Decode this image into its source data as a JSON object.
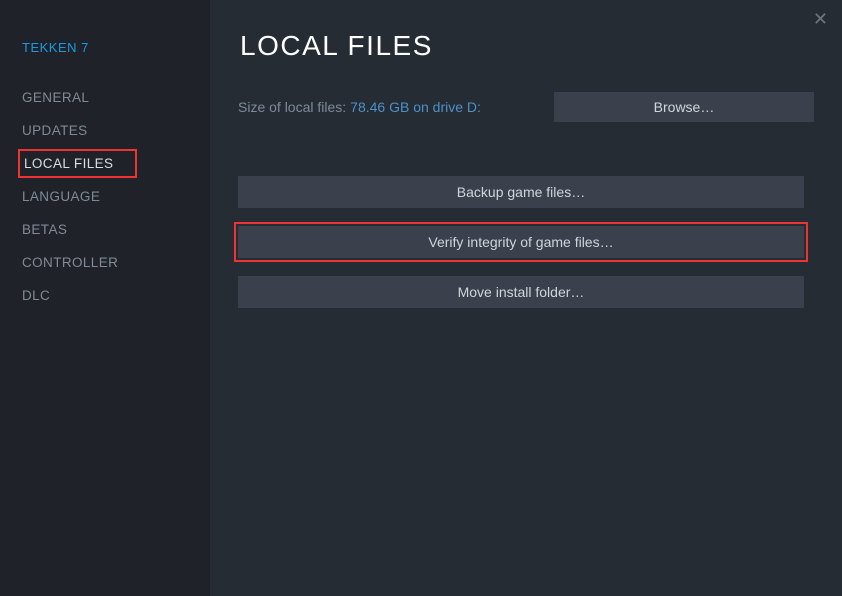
{
  "game_title": "TEKKEN 7",
  "nav": {
    "general": "GENERAL",
    "updates": "UPDATES",
    "local_files": "LOCAL FILES",
    "language": "LANGUAGE",
    "betas": "BETAS",
    "controller": "CONTROLLER",
    "dlc": "DLC"
  },
  "page_title": "LOCAL FILES",
  "size_label": "Size of local files:",
  "size_value": "78.46 GB on drive D:",
  "buttons": {
    "browse": "Browse…",
    "backup": "Backup game files…",
    "verify": "Verify integrity of game files…",
    "move": "Move install folder…"
  }
}
